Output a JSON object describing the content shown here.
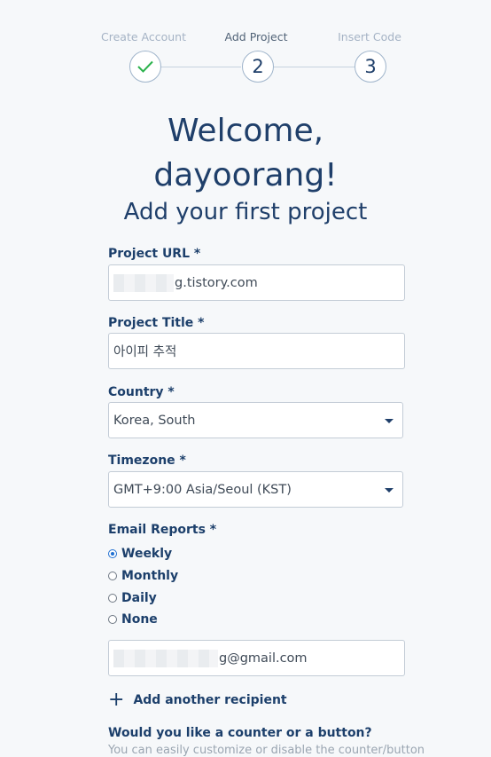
{
  "stepper": {
    "steps": [
      {
        "label": "Create Account",
        "marker": "",
        "status": "done"
      },
      {
        "label": "Add Project",
        "marker": "2",
        "status": "active"
      },
      {
        "label": "Insert Code",
        "marker": "3",
        "status": "upcoming"
      }
    ]
  },
  "header": {
    "welcome_line1": "Welcome,",
    "welcome_line2": "dayoorang!",
    "subtitle": "Add your first project"
  },
  "form": {
    "project_url": {
      "label": "Project URL *",
      "value_suffix": "g.tistory.com"
    },
    "project_title": {
      "label": "Project Title *",
      "value": "아이피 추적"
    },
    "country": {
      "label": "Country *",
      "value": "Korea, South"
    },
    "timezone": {
      "label": "Timezone *",
      "value": "GMT+9:00 Asia/Seoul (KST)"
    },
    "email_reports": {
      "label": "Email Reports *",
      "options": [
        "Weekly",
        "Monthly",
        "Daily",
        "None"
      ],
      "selected": "Weekly"
    },
    "recipient_email": {
      "value_suffix": "g@gmail.com"
    },
    "add_recipient_label": "Add another recipient",
    "counter_question": "Would you like a counter or a button?",
    "counter_description": "You can easily customize or disable the counter/button"
  },
  "colors": {
    "primary_text": "#1f3f6a",
    "check": "#2bb24c",
    "radio_selected": "#1f6fd1"
  }
}
